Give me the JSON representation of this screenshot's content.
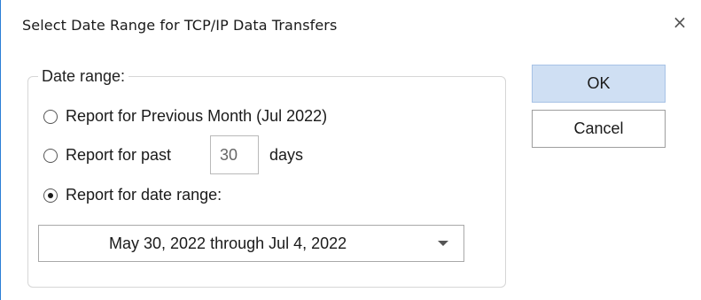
{
  "dialog": {
    "title": "Select Date Range for TCP/IP Data Transfers",
    "close_glyph": "×"
  },
  "group": {
    "legend": "Date range:",
    "options": [
      {
        "label": "Report for Previous Month (Jul 2022)",
        "checked": false
      },
      {
        "label": "Report for past",
        "checked": false
      },
      {
        "label": "Report for date range:",
        "checked": true
      }
    ],
    "past_days_value": "30",
    "days_suffix": "days",
    "date_range_value": "May 30, 2022 through Jul 4, 2022"
  },
  "buttons": {
    "ok_label": "OK",
    "cancel_label": "Cancel"
  },
  "icons": {
    "close": "close-icon",
    "dropdown": "chevron-down-icon"
  },
  "colors": {
    "accent_border": "#2b7fd6",
    "ok_button_bg": "#cfdff3"
  }
}
